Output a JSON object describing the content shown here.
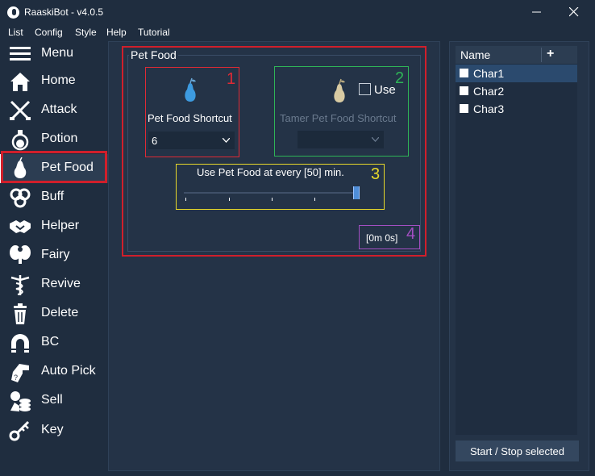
{
  "window": {
    "title": "RaaskiBot - v4.0.5"
  },
  "menu": [
    "List",
    "Config",
    "Style",
    "Help",
    "Tutorial"
  ],
  "sidebar": {
    "items": [
      {
        "label": "Menu",
        "icon": "hamburger-icon"
      },
      {
        "label": "Home",
        "icon": "home-icon"
      },
      {
        "label": "Attack",
        "icon": "crossed-swords-icon"
      },
      {
        "label": "Potion",
        "icon": "potion-icon"
      },
      {
        "label": "Pet Food",
        "icon": "pear-icon"
      },
      {
        "label": "Buff",
        "icon": "swirl-icon"
      },
      {
        "label": "Helper",
        "icon": "handshake-icon"
      },
      {
        "label": "Fairy",
        "icon": "fairy-icon"
      },
      {
        "label": "Revive",
        "icon": "caduceus-icon"
      },
      {
        "label": "Delete",
        "icon": "trash-icon"
      },
      {
        "label": "BC",
        "icon": "magnet-icon"
      },
      {
        "label": "Auto Pick",
        "icon": "grab-hand-icon"
      },
      {
        "label": "Sell",
        "icon": "coins-icon"
      },
      {
        "label": "Key",
        "icon": "key-icon"
      }
    ],
    "active": "Pet Food"
  },
  "pet_food": {
    "group_title": "Pet Food",
    "pet_food_shortcut_label": "Pet Food Shortcut",
    "pet_food_shortcut_value": "6",
    "tamer_shortcut_label": "Tamer Pet Food Shortcut",
    "tamer_shortcut_value": "",
    "use_label": "Use",
    "use_checked": false,
    "slider_label": "Use Pet Food at every [50] min.",
    "slider_value": 50,
    "timer": "[0m 0s]",
    "annotations": [
      "1",
      "2",
      "3",
      "4"
    ]
  },
  "char_list": {
    "header": "Name",
    "add": "+",
    "chars": [
      {
        "name": "Char1",
        "checked": false,
        "selected": true
      },
      {
        "name": "Char2",
        "checked": false,
        "selected": false
      },
      {
        "name": "Char3",
        "checked": false,
        "selected": false
      }
    ],
    "start_button": "Start / Stop selected"
  },
  "colors": {
    "background": "#1f2d3f",
    "panel": "#243347",
    "highlight_red": "#d01f2b",
    "green": "#2fb457",
    "yellow": "#e8d92a",
    "purple": "#a34fc2",
    "accent_blue": "#4f8ed8",
    "pear_blue": "#3d9be0",
    "pear_beige": "#d9cba3"
  }
}
